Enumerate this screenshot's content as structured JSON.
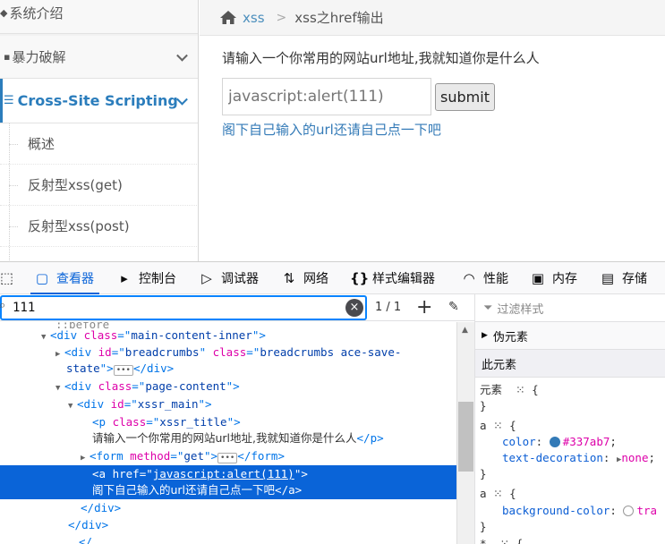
{
  "sidebar": {
    "items": [
      {
        "label": "系统介绍"
      },
      {
        "label": "暴力破解"
      },
      {
        "label": "Cross-Site Scripting"
      }
    ],
    "sub_items": [
      {
        "label": "概述"
      },
      {
        "label": "反射型xss(get)"
      },
      {
        "label": "反射型xss(post)"
      }
    ]
  },
  "breadcrumb": {
    "home_link": "xss",
    "separator": ">",
    "current": "xss之href输出"
  },
  "main": {
    "title": "请输入一个你常用的网站url地址,我就知道你是什么人",
    "input_placeholder": "javascript:alert(111)",
    "submit_label": "submit",
    "result_link": "阁下自己输入的url还请自己点一下吧",
    "link_color": "#337ab7"
  },
  "devtools": {
    "tabs": [
      {
        "label": "查看器",
        "icon": "inspector-icon"
      },
      {
        "label": "控制台",
        "icon": "console-icon"
      },
      {
        "label": "调试器",
        "icon": "debugger-icon"
      },
      {
        "label": "网络",
        "icon": "network-icon"
      },
      {
        "label": "样式编辑器",
        "icon": "style-editor-icon"
      },
      {
        "label": "性能",
        "icon": "performance-icon"
      },
      {
        "label": "内存",
        "icon": "memory-icon"
      },
      {
        "label": "存储",
        "icon": "storage-icon"
      }
    ],
    "search_query": "111",
    "match_count": "1 / 1",
    "markup": {
      "before": "::before",
      "div": "div",
      "a": "a",
      "p": "p",
      "form": "form",
      "class_attr": "class",
      "id_attr": "id",
      "method_attr": "method",
      "href_attr": "href",
      "main_content_inner": "main-content-inner",
      "breadcrumbs_id": "breadcrumbs",
      "breadcrumbs_class_1": "breadcrumbs ace-save-",
      "breadcrumbs_class_2": "state",
      "page_content": "page-content",
      "xssr_main": "xssr_main",
      "xssr_title": "xssr_title",
      "p_text": "请输入一个你常用的网站url地址,我就知道你是什么人",
      "form_method": "get",
      "href_value": "javascript:alert(111)",
      "a_text": "阁下自己输入的url还请自己点一下吧"
    },
    "rules": {
      "filter_placeholder": "过滤样式",
      "pseudo_header": "伪元素",
      "this_element_header": "此元素",
      "element_label": "元素",
      "rule1_selector": "a",
      "rule1_prop1": "color",
      "rule1_val1": "#337ab7",
      "rule1_prop2": "text-decoration",
      "rule1_val2": "none",
      "rule2_selector": "a",
      "rule2_prop1": "background-color",
      "rule2_val1": "tra",
      "rule3_selector": "*"
    }
  }
}
